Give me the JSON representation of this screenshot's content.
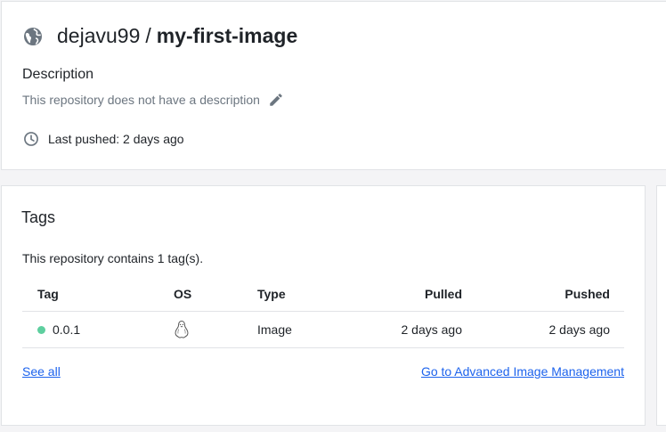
{
  "repo": {
    "namespace": "dejavu99",
    "separator": "/",
    "name": "my-first-image",
    "description_heading": "Description",
    "description_text": "This repository does not have a description",
    "last_pushed": "Last pushed: 2 days ago"
  },
  "tags": {
    "heading": "Tags",
    "count_text": "This repository contains 1 tag(s).",
    "columns": [
      "Tag",
      "OS",
      "Type",
      "Pulled",
      "Pushed"
    ],
    "rows": [
      {
        "tag": "0.0.1",
        "os_icon": "linux-icon",
        "type": "Image",
        "pulled": "2 days ago",
        "pushed": "2 days ago",
        "status_color": "#5ecf9f"
      }
    ],
    "see_all": "See all",
    "advanced_link": "Go to Advanced Image Management"
  },
  "colors": {
    "link": "#1d63ed",
    "muted": "#6c7680",
    "status": "#5ecf9f"
  }
}
